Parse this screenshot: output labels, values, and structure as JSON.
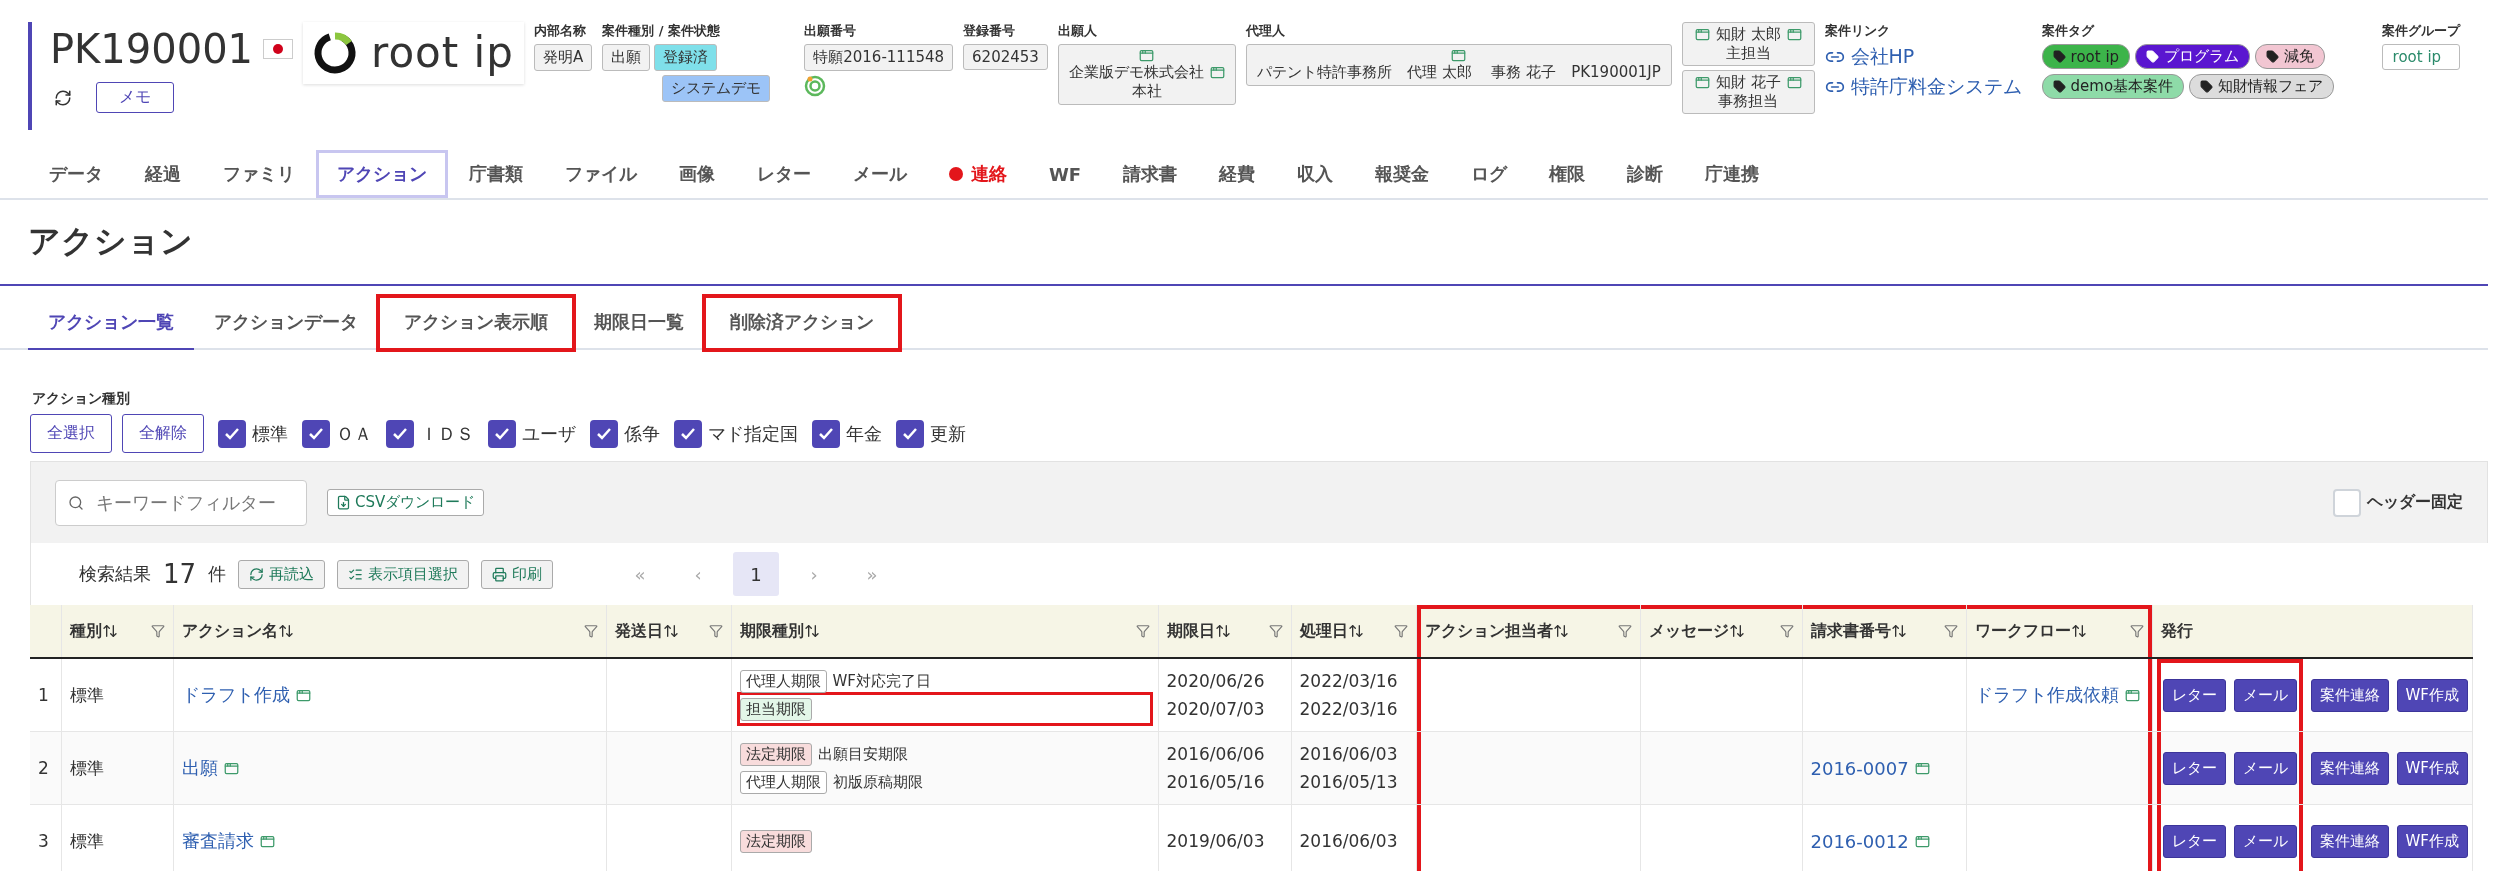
{
  "header": {
    "case_number": "PK190001",
    "logo_text": "root ip",
    "memo_button": "メモ",
    "internal_name": {
      "label": "内部名称",
      "value": "発明A"
    },
    "case_type_status": {
      "label": "案件種別 / 案件状態",
      "chips": [
        {
          "text": "出願",
          "kind": "plain"
        },
        {
          "text": "登録済",
          "kind": "status"
        },
        {
          "text": "システムデモ",
          "kind": "group"
        }
      ]
    },
    "application_number": {
      "label": "出願番号",
      "value": "特願2016-111548"
    },
    "registration_number": {
      "label": "登録番号",
      "value": "6202453"
    },
    "applicant": {
      "label": "出願人",
      "lines": [
        "企業版デモ株式会社",
        "本社"
      ]
    },
    "agent": {
      "label": "代理人",
      "value": "パテント特許事務所　代理 太郎　 事務 花子　PK190001JP"
    },
    "staff": [
      {
        "name": "知財 太郎",
        "role": "主担当"
      },
      {
        "name": "知財 花子",
        "role": "事務担当"
      }
    ],
    "links": {
      "label": "案件リンク",
      "items": [
        "会社HP",
        "特許庁料金システム"
      ]
    },
    "tags": {
      "label": "案件タグ",
      "items": [
        {
          "text": "root ip",
          "color": "#3cb44a"
        },
        {
          "text": "プログラム",
          "color": "#5a16d0"
        },
        {
          "text": "減免",
          "color": "#f2c6d2"
        },
        {
          "text": "demo基本案件",
          "color": "#8edba8"
        },
        {
          "text": "知財情報フェア",
          "color": "#dcdcdc"
        }
      ]
    },
    "group": {
      "label": "案件グループ",
      "value": "root ip"
    }
  },
  "nav_tabs": [
    {
      "label": "データ",
      "selected": false,
      "alert": false
    },
    {
      "label": "経過",
      "selected": false,
      "alert": false
    },
    {
      "label": "ファミリ",
      "selected": false,
      "alert": false
    },
    {
      "label": "アクション",
      "selected": true,
      "alert": false
    },
    {
      "label": "庁書類",
      "selected": false,
      "alert": false
    },
    {
      "label": "ファイル",
      "selected": false,
      "alert": false
    },
    {
      "label": "画像",
      "selected": false,
      "alert": false
    },
    {
      "label": "レター",
      "selected": false,
      "alert": false
    },
    {
      "label": "メール",
      "selected": false,
      "alert": false
    },
    {
      "label": "連絡",
      "selected": false,
      "alert": true
    },
    {
      "label": "WF",
      "selected": false,
      "alert": false
    },
    {
      "label": "請求書",
      "selected": false,
      "alert": false
    },
    {
      "label": "経費",
      "selected": false,
      "alert": false
    },
    {
      "label": "収入",
      "selected": false,
      "alert": false
    },
    {
      "label": "報奨金",
      "selected": false,
      "alert": false
    },
    {
      "label": "ログ",
      "selected": false,
      "alert": false
    },
    {
      "label": "権限",
      "selected": false,
      "alert": false
    },
    {
      "label": "診断",
      "selected": false,
      "alert": false
    },
    {
      "label": "庁連携",
      "selected": false,
      "alert": false
    }
  ],
  "page_title": "アクション",
  "sub_tabs": [
    {
      "label": "アクション一覧",
      "selected": true,
      "highlighted": false
    },
    {
      "label": "アクションデータ",
      "selected": false,
      "highlighted": false
    },
    {
      "label": "アクション表示順",
      "selected": false,
      "highlighted": true
    },
    {
      "label": "期限日一覧",
      "selected": false,
      "highlighted": false
    },
    {
      "label": "削除済アクション",
      "selected": false,
      "highlighted": true
    }
  ],
  "action_types": {
    "label": "アクション種別",
    "buttons": [
      "全選択",
      "全解除"
    ],
    "options": [
      {
        "label": "標準",
        "checked": true
      },
      {
        "label": "ＯＡ",
        "checked": true
      },
      {
        "label": "ＩＤＳ",
        "checked": true
      },
      {
        "label": "ユーザ",
        "checked": true
      },
      {
        "label": "係争",
        "checked": true
      },
      {
        "label": "マド指定国",
        "checked": true
      },
      {
        "label": "年金",
        "checked": true
      },
      {
        "label": "更新",
        "checked": true
      }
    ]
  },
  "toolbar": {
    "search": {
      "placeholder": "キーワードフィルター"
    },
    "csv_button": "CSVダウンロード",
    "fixed_header": {
      "label": "ヘッダー固定",
      "checked": false
    }
  },
  "results": {
    "label": "検索結果",
    "count": "17",
    "unit": "件",
    "buttons": [
      {
        "label": "再読込",
        "kind": "reload"
      },
      {
        "label": "表示項目選択",
        "kind": "columns"
      },
      {
        "label": "印刷",
        "kind": "print"
      }
    ],
    "pagination": [
      {
        "label": "«",
        "selected": false
      },
      {
        "label": "‹",
        "selected": false
      },
      {
        "label": "1",
        "selected": true
      },
      {
        "label": "›",
        "selected": false
      },
      {
        "label": "»",
        "selected": false
      }
    ]
  },
  "table": {
    "columns": [
      {
        "highlighted": false
      },
      {
        "label": "種別",
        "sortable": true,
        "highlighted": false
      },
      {
        "label": "アクション名",
        "sortable": true,
        "highlighted": false
      },
      {
        "label": "発送日",
        "sortable": true,
        "highlighted": false
      },
      {
        "label": "期限種別",
        "sortable": true,
        "highlighted": false
      },
      {
        "label": "期限日",
        "sortable": true,
        "highlighted": false
      },
      {
        "label": "処理日",
        "sortable": true,
        "highlighted": false
      },
      {
        "label": "アクション担当者",
        "sortable": true,
        "highlighted": true
      },
      {
        "label": "メッセージ",
        "sortable": true,
        "highlighted": true
      },
      {
        "label": "請求書番号",
        "sortable": true,
        "highlighted": true
      },
      {
        "label": "ワークフロー",
        "sortable": true,
        "highlighted": true
      },
      {
        "label": "発行",
        "sortable": false,
        "highlighted": false
      }
    ],
    "rows": [
      {
        "number": "1",
        "type": "標準",
        "name": "ドラフト作成",
        "deadlines": [
          {
            "tag": "代理人期限",
            "kind": "agent",
            "text": "WF対応完了日",
            "due": "2020/06/26",
            "done": "2022/03/16",
            "highlighted": false
          },
          {
            "tag": "担当期限",
            "kind": "staff",
            "due": "2020/07/03",
            "done": "2022/03/16",
            "highlighted": true
          }
        ],
        "workflow": "ドラフト作成依頼",
        "actions": [
          {
            "label": "レター",
            "highlighted": true
          },
          {
            "label": "メール",
            "highlighted": true
          },
          {
            "label": "案件連絡",
            "highlighted": false
          },
          {
            "label": "WF作成",
            "highlighted": false
          }
        ]
      },
      {
        "number": "2",
        "type": "標準",
        "name": "出願",
        "deadlines": [
          {
            "tag": "法定期限",
            "kind": "legal",
            "text": "出願目安期限",
            "due": "2016/06/06",
            "done": "2016/06/03",
            "highlighted": false
          },
          {
            "tag": "代理人期限",
            "kind": "agent",
            "text": "初版原稿期限",
            "due": "2016/05/16",
            "done": "2016/05/13",
            "highlighted": false
          }
        ],
        "invoice": "2016-0007",
        "actions": [
          {
            "label": "レター",
            "highlighted": true
          },
          {
            "label": "メール",
            "highlighted": true
          },
          {
            "label": "案件連絡",
            "highlighted": false
          },
          {
            "label": "WF作成",
            "highlighted": false
          }
        ]
      },
      {
        "number": "3",
        "type": "標準",
        "name": "審査請求",
        "deadlines": [
          {
            "tag": "法定期限",
            "kind": "legal",
            "due": "2019/06/03",
            "done": "2016/06/03",
            "highlighted": false
          }
        ],
        "invoice": "2016-0012",
        "actions": [
          {
            "label": "レター",
            "highlighted": true
          },
          {
            "label": "メール",
            "highlighted": true
          },
          {
            "label": "案件連絡",
            "highlighted": false
          },
          {
            "label": "WF作成",
            "highlighted": false
          }
        ]
      }
    ]
  }
}
